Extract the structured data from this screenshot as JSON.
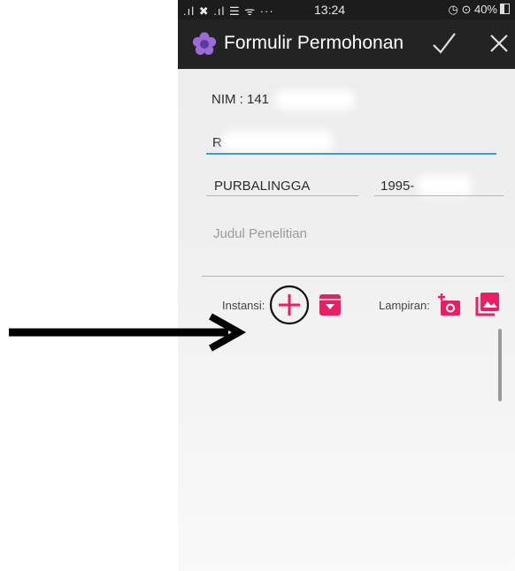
{
  "status": {
    "left_icons": ".ıl ✖ .ıl ☰ ᯤ ···",
    "time": "13:24",
    "battery": "◷ ⊙ 40%"
  },
  "appbar": {
    "title": "Formulir Permohonan",
    "confirm_icon": "check-icon",
    "close_icon": "close-icon",
    "accent": "#e91e63"
  },
  "form": {
    "nim_label": "NIM : 141",
    "name_value": "R",
    "city_value": "PURBALINGGA",
    "date_value": "1995-",
    "judul_placeholder": "Judul Penelitian",
    "instansi_label": "Instansi:",
    "lampiran_label": "Lampiran:"
  }
}
